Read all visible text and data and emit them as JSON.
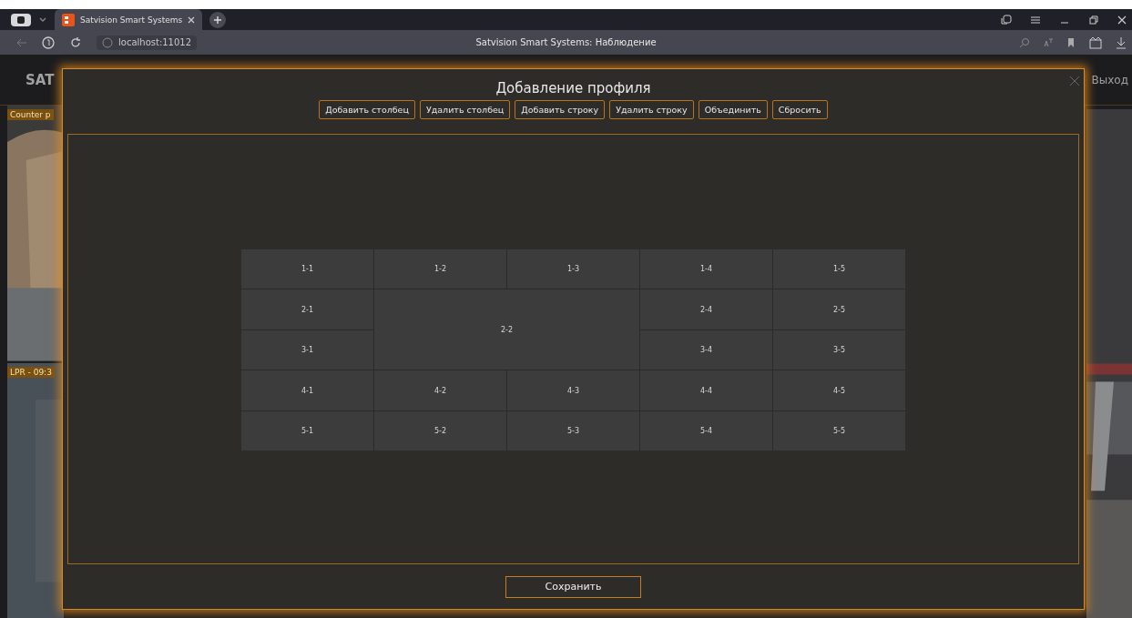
{
  "browser": {
    "tab_title": "Satvision Smart Systems",
    "address": "localhost:11012",
    "page_title": "Satvision Smart Systems: Наблюдение"
  },
  "app": {
    "logo": "SAT",
    "logout": "Выход",
    "cameras": [
      {
        "label": "Counter p",
        "kind": "picture"
      },
      {
        "label": "LPR - 09:3",
        "kind": "picture"
      }
    ]
  },
  "dialog": {
    "title": "Добавление профиля",
    "toolbar": [
      "Добавить столбец",
      "Удалить столбец",
      "Добавить строку",
      "Удалить строку",
      "Объединить",
      "Сбросить"
    ],
    "layout_cells": [
      {
        "label": "1-1",
        "merged": false
      },
      {
        "label": "1-2",
        "merged": false
      },
      {
        "label": "1-3",
        "merged": false
      },
      {
        "label": "1-4",
        "merged": false
      },
      {
        "label": "1-5",
        "merged": false
      },
      {
        "label": "2-1",
        "merged": false
      },
      {
        "label": "2-2",
        "merged": true
      },
      {
        "label": "2-4",
        "merged": false
      },
      {
        "label": "2-5",
        "merged": false
      },
      {
        "label": "3-1",
        "merged": false
      },
      {
        "label": "3-4",
        "merged": false
      },
      {
        "label": "3-5",
        "merged": false
      },
      {
        "label": "4-1",
        "merged": false
      },
      {
        "label": "4-2",
        "merged": false
      },
      {
        "label": "4-3",
        "merged": false
      },
      {
        "label": "4-4",
        "merged": false
      },
      {
        "label": "4-5",
        "merged": false
      },
      {
        "label": "5-1",
        "merged": false
      },
      {
        "label": "5-2",
        "merged": false
      },
      {
        "label": "5-3",
        "merged": false
      },
      {
        "label": "5-4",
        "merged": false
      },
      {
        "label": "5-5",
        "merged": false
      }
    ],
    "save": "Сохранить"
  }
}
